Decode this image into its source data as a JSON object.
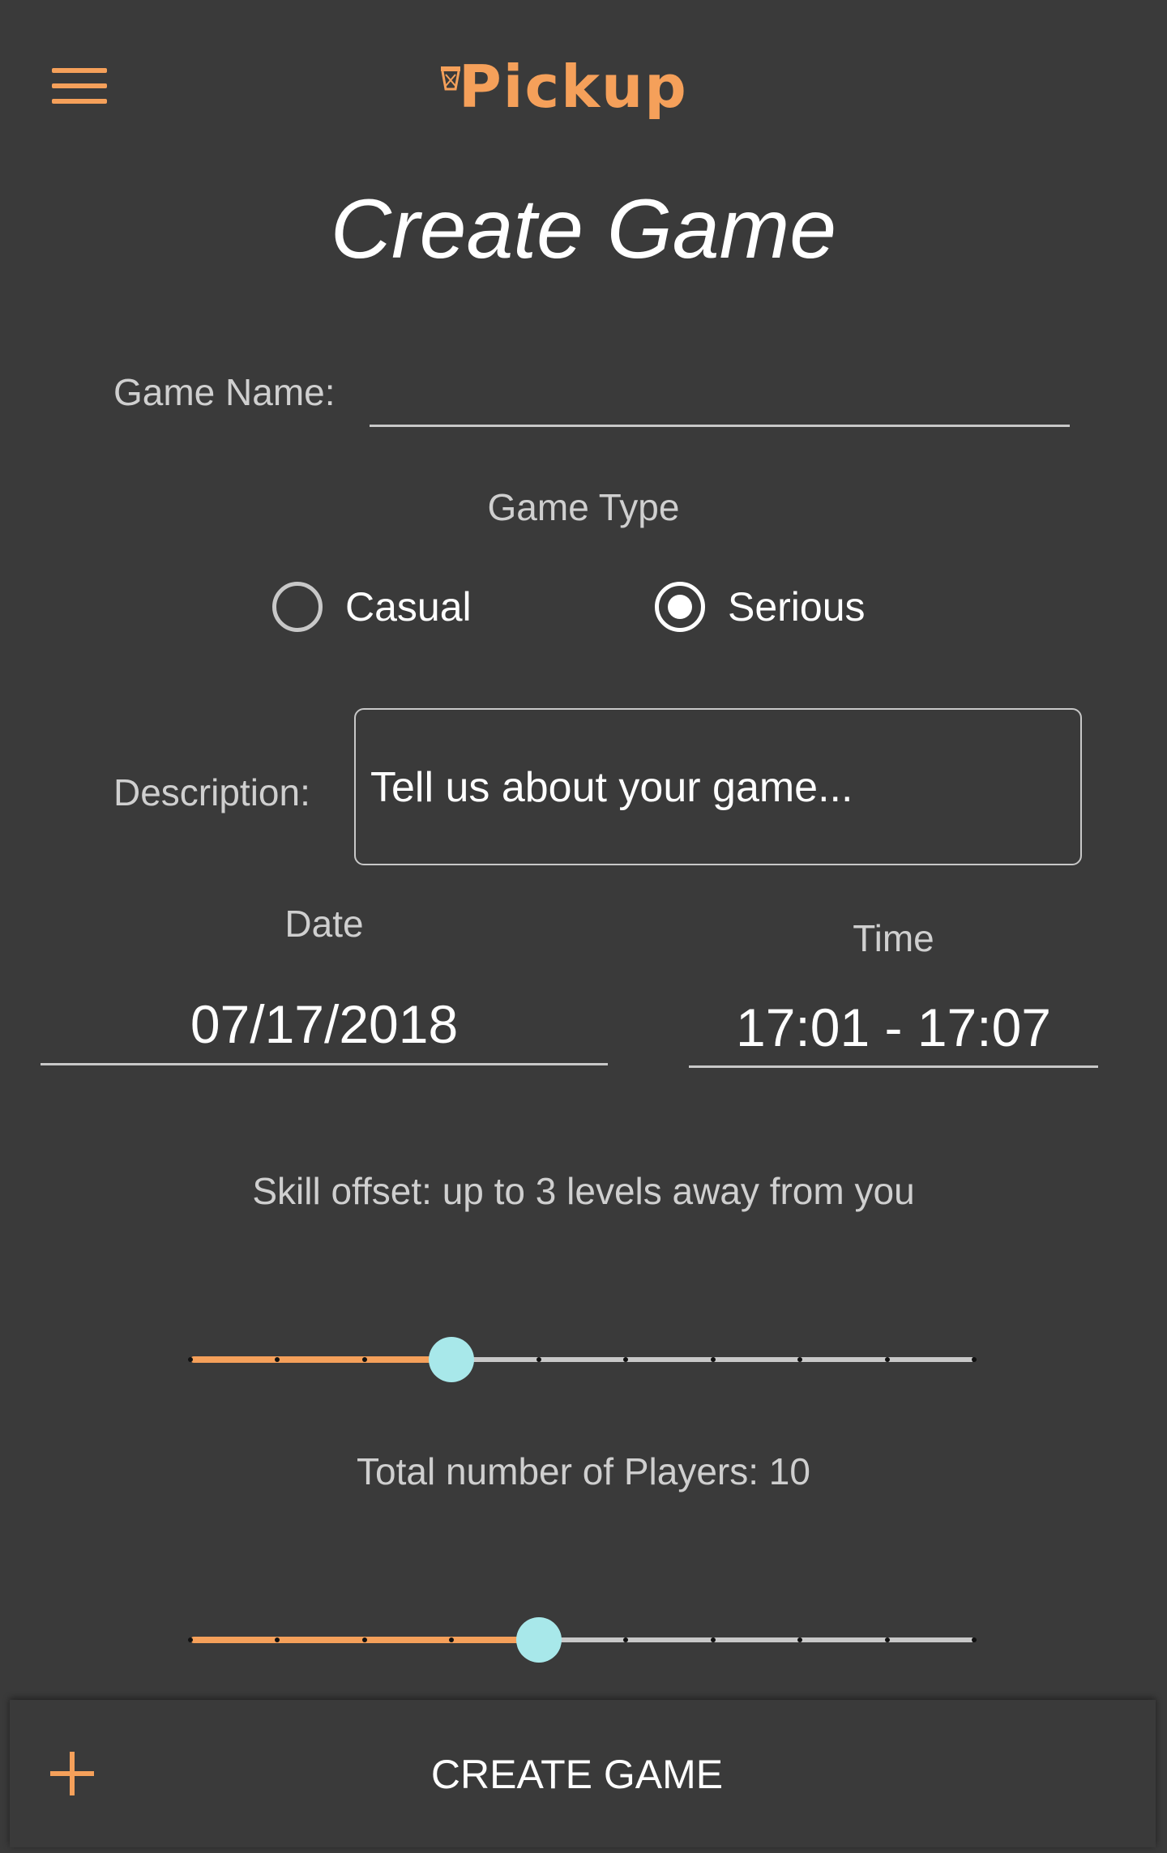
{
  "header": {
    "menu_icon": "hamburger-menu-icon",
    "logo_text": "Pickup",
    "accent_color": "#f5a05a"
  },
  "page": {
    "title": "Create Game"
  },
  "form": {
    "game_name": {
      "label": "Game Name:",
      "value": ""
    },
    "game_type": {
      "label": "Game Type",
      "options": [
        "Casual",
        "Serious"
      ],
      "selected": "Serious"
    },
    "description": {
      "label": "Description:",
      "placeholder": "Tell us about your game..."
    },
    "date": {
      "label": "Date",
      "value": "07/17/2018"
    },
    "time": {
      "label": "Time",
      "value": "17:01 - 17:07"
    },
    "skill_offset": {
      "label": "Skill offset: up to 3 levels away from you",
      "value": 3,
      "min": 0,
      "max": 9,
      "fill_color": "#f5a05a",
      "thumb_color": "#a8e8ea"
    },
    "players": {
      "label": "Total number of Players: 10",
      "value": 10,
      "min": 2,
      "max": 20,
      "step": 2
    }
  },
  "bottom_bar": {
    "plus_icon": "plus-icon",
    "create_label": "CREATE GAME"
  }
}
